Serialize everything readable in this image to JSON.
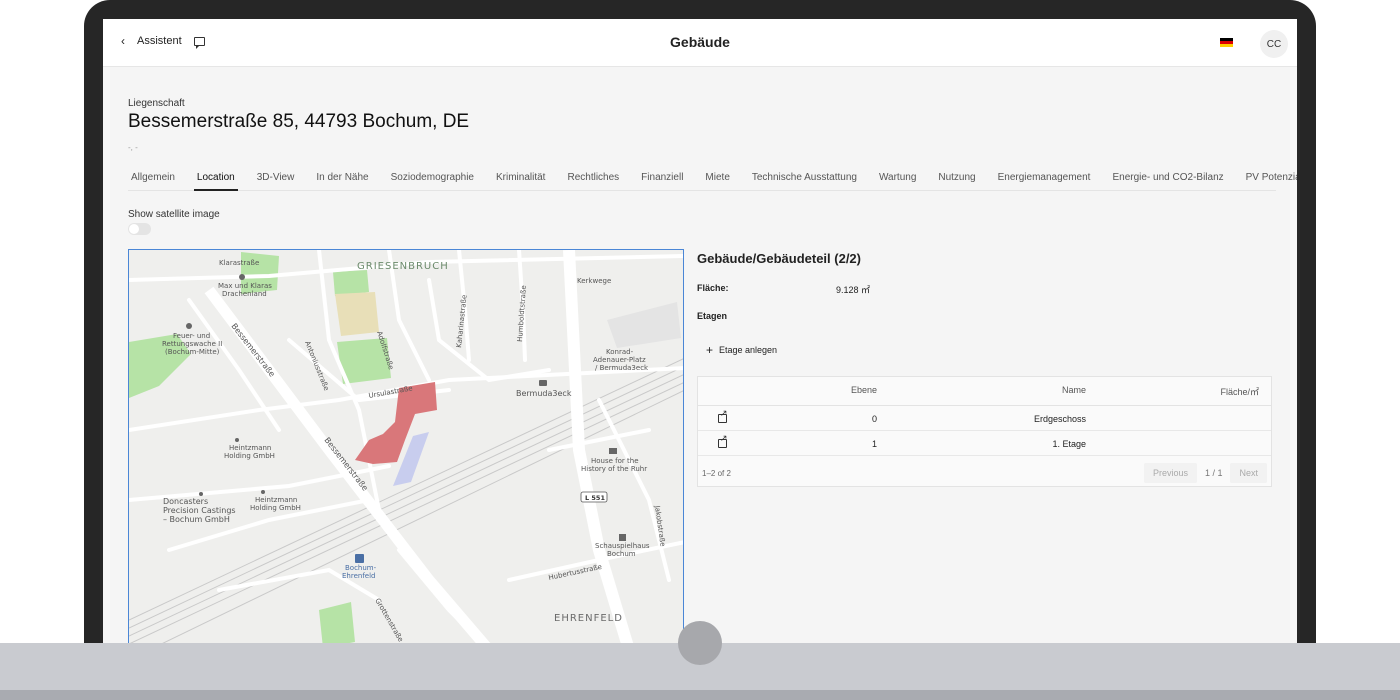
{
  "header": {
    "back_label": "Assistent",
    "title": "Gebäude",
    "avatar_initials": "CC"
  },
  "property": {
    "label": "Liegenschaft",
    "address": "Bessemerstraße 85, 44793 Bochum, DE",
    "subtitle": "-, -"
  },
  "tabs": [
    {
      "label": "Allgemein",
      "active": false
    },
    {
      "label": "Location",
      "active": true
    },
    {
      "label": "3D-View",
      "active": false
    },
    {
      "label": "In der Nähe",
      "active": false
    },
    {
      "label": "Soziodemographie",
      "active": false
    },
    {
      "label": "Kriminalität",
      "active": false
    },
    {
      "label": "Rechtliches",
      "active": false
    },
    {
      "label": "Finanziell",
      "active": false
    },
    {
      "label": "Miete",
      "active": false
    },
    {
      "label": "Technische Ausstattung",
      "active": false
    },
    {
      "label": "Wartung",
      "active": false
    },
    {
      "label": "Nutzung",
      "active": false
    },
    {
      "label": "Energiemanagement",
      "active": false
    },
    {
      "label": "Energie- und CO2-Bilanz",
      "active": false
    },
    {
      "label": "PV Potenzial",
      "active": false
    }
  ],
  "satellite": {
    "label": "Show satellite image",
    "enabled": false
  },
  "map": {
    "labels": {
      "griesenbruch": "GRIESENBRUCH",
      "ehrenfeld_district": "EHRENFELD",
      "klarastrasse": "Klarastraße",
      "kerkwege": "Kerkwege",
      "max_klaras": "Max und Klaras",
      "drachenland": "Drachenland",
      "feuer1": "Feuer- und",
      "feuer2": "Rettungswache II",
      "feuer3": "(Bochum-Mitte)",
      "bessemer1": "Bessemerstraße",
      "bessemer2": "Bessemerstraße",
      "antonius": "Antoniusstraße",
      "adolf": "Adolfstraße",
      "kaharina": "Kaharinastraße",
      "humboldt": "Humboldtstraße",
      "konrad1": "Konrad-",
      "konrad2": "Adenauer-Platz",
      "konrad3": "/ Bermuda3eck",
      "ursula": "Ursulastraße",
      "bermuda": "Bermuda3eck",
      "heintzmann1a": "Heintzmann",
      "heintzmann1b": "Holding GmbH",
      "heintzmann2a": "Heintzmann",
      "heintzmann2b": "Holding GmbH",
      "house1": "House for the",
      "house2": "History of the Ruhr",
      "l551": "L 551",
      "doncasters1": "Doncasters",
      "doncasters2": "Precision Castings",
      "doncasters3": "– Bochum GmbH",
      "jakobs": "Jakobstraße",
      "schauspiel1": "Schauspielhaus",
      "schauspiel2": "Bochum",
      "hubertus": "Hubertusstraße",
      "bochum_ehrenfeld1": "Bochum-",
      "bochum_ehrenfeld2": "Ehrenfeld",
      "grotten": "Grottenstraße"
    }
  },
  "building": {
    "title": "Gebäude/Gebäudeteil (2/2)",
    "area_label": "Fläche:",
    "area_value": "9.128 ㎡",
    "floors_label": "Etagen",
    "add_floor_label": "Etage anlegen",
    "table": {
      "headers": {
        "ebene": "Ebene",
        "name": "Name",
        "flaeche": "Fläche/㎡"
      },
      "rows": [
        {
          "ebene": "0",
          "name": "Erdgeschoss",
          "flaeche": ""
        },
        {
          "ebene": "1",
          "name": "1. Etage",
          "flaeche": ""
        }
      ],
      "count": "1–2 of 2",
      "prev_label": "Previous",
      "page": "1 / 1",
      "next_label": "Next"
    }
  },
  "colors": {
    "map_border": "#4a86d6",
    "building_highlight": "#d9777a",
    "park": "#a8df9c",
    "flag_black": "#000000",
    "flag_red": "#dd0000",
    "flag_gold": "#ffce00"
  }
}
